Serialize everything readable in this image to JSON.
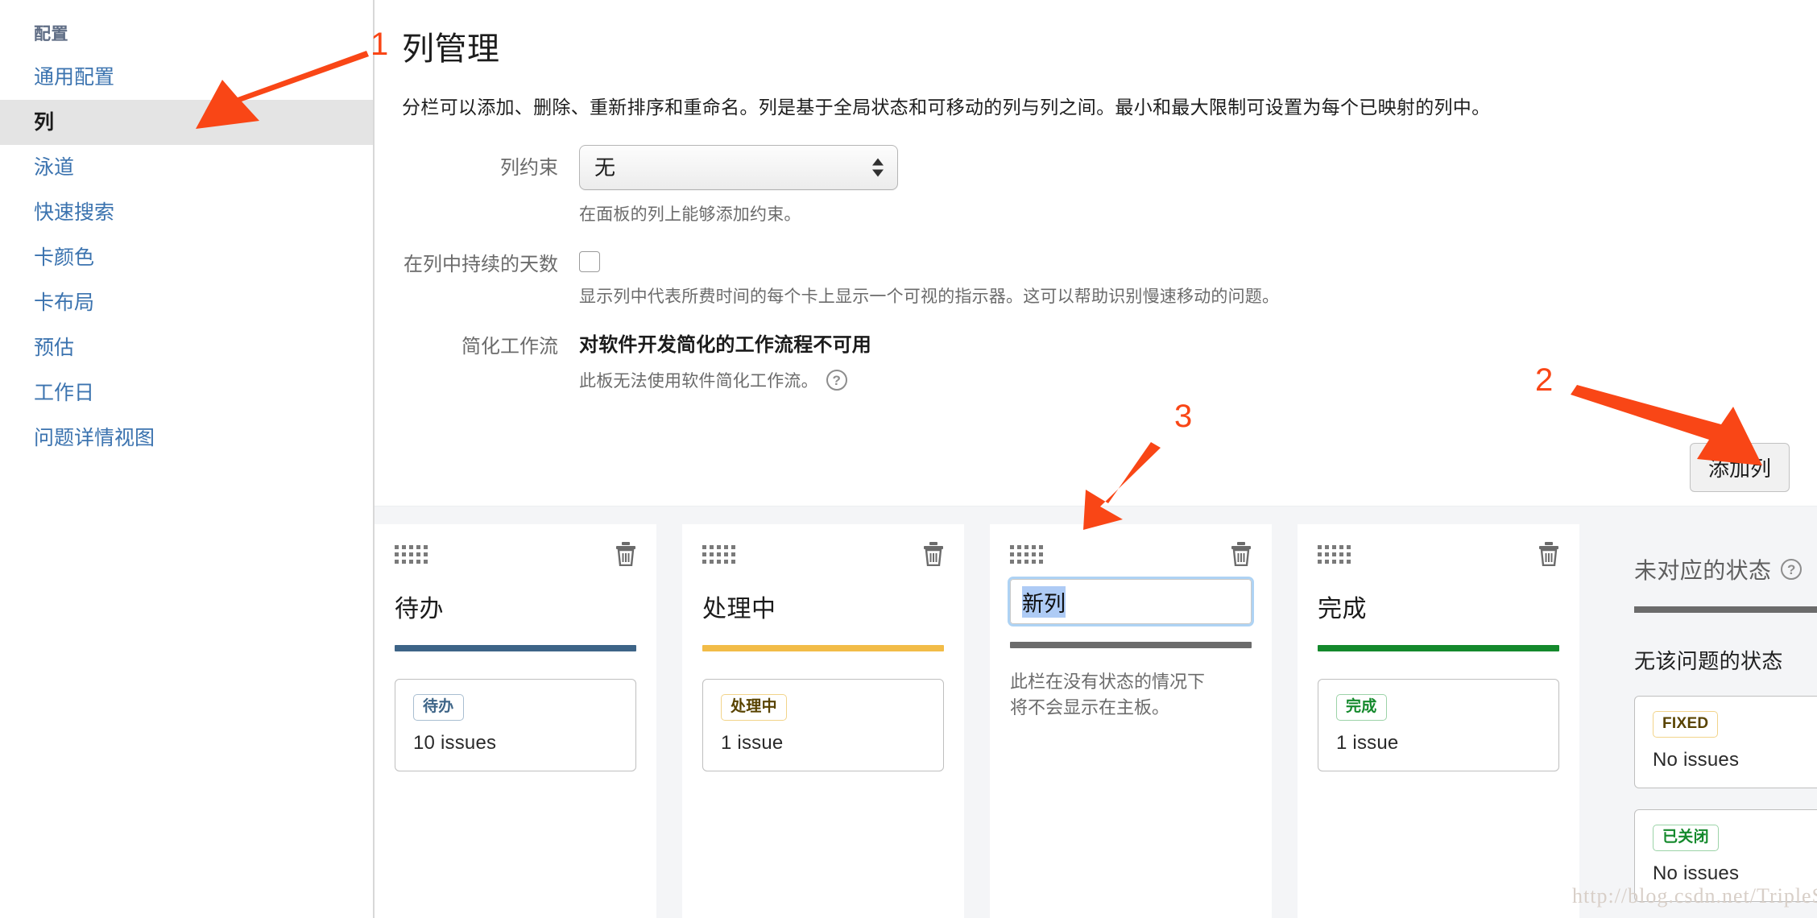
{
  "sidebar": {
    "heading": "配置",
    "items": [
      {
        "label": "通用配置",
        "active": false
      },
      {
        "label": "列",
        "active": true
      },
      {
        "label": "泳道",
        "active": false
      },
      {
        "label": "快速搜索",
        "active": false
      },
      {
        "label": "卡颜色",
        "active": false
      },
      {
        "label": "卡布局",
        "active": false
      },
      {
        "label": "预估",
        "active": false
      },
      {
        "label": "工作日",
        "active": false
      },
      {
        "label": "问题详情视图",
        "active": false
      }
    ]
  },
  "main": {
    "title": "列管理",
    "description": "分栏可以添加、删除、重新排序和重命名。列是基于全局状态和可移动的列与列之间。最小和最大限制可设置为每个已映射的列中。",
    "form": {
      "constraint_label": "列约束",
      "constraint_value": "无",
      "constraint_help": "在面板的列上能够添加约束。",
      "days_label": "在列中持续的天数",
      "days_checked": false,
      "days_help": "显示列中代表所费时间的每个卡上显示一个可视的指示器。这可以帮助识别慢速移动的问题。",
      "workflow_label": "简化工作流",
      "workflow_value": "对软件开发简化的工作流程不可用",
      "workflow_help": "此板无法使用软件简化工作流。",
      "help_icon": "?"
    },
    "add_column_button": "添加列"
  },
  "columns": [
    {
      "name": "待办",
      "editing": false,
      "bar_color": "#3d6487",
      "note": "",
      "statuses": [
        {
          "label": "待办",
          "issues": "10 issues",
          "fg": "#3d6487",
          "bg": "#ffffff",
          "border": "#a9bed1"
        }
      ]
    },
    {
      "name": "处理中",
      "editing": false,
      "bar_color": "#f2bc48",
      "note": "",
      "statuses": [
        {
          "label": "处理中",
          "issues": "1 issue",
          "fg": "#594300",
          "bg": "#ffffff",
          "border": "#f2d48a"
        }
      ]
    },
    {
      "name": "新列",
      "editing": true,
      "bar_color": "#6b6b6b",
      "note": "此栏在没有状态的情况下将不会显示在主板。",
      "statuses": []
    },
    {
      "name": "完成",
      "editing": false,
      "bar_color": "#14892c",
      "note": "",
      "statuses": [
        {
          "label": "完成",
          "issues": "1 issue",
          "fg": "#14892c",
          "bg": "#ffffff",
          "border": "#9cd3a8"
        }
      ]
    }
  ],
  "unmapped": {
    "title": "未对应的状态",
    "help_icon": "?",
    "subtitle": "无该问题的状态",
    "statuses": [
      {
        "label": "FIXED",
        "issues": "No issues",
        "fg": "#594300",
        "bg": "#ffffff",
        "border": "#f2d48a"
      },
      {
        "label": "已关闭",
        "issues": "No issues",
        "fg": "#14892c",
        "bg": "#ffffff",
        "border": "#9cd3a8"
      }
    ]
  },
  "annotations": {
    "accent": "#f94616",
    "markers": [
      {
        "id": "1",
        "text": "1"
      },
      {
        "id": "2",
        "text": "2"
      },
      {
        "id": "3",
        "text": "3"
      }
    ]
  },
  "watermark": "http://blog.csdn.net/TripleS_X"
}
